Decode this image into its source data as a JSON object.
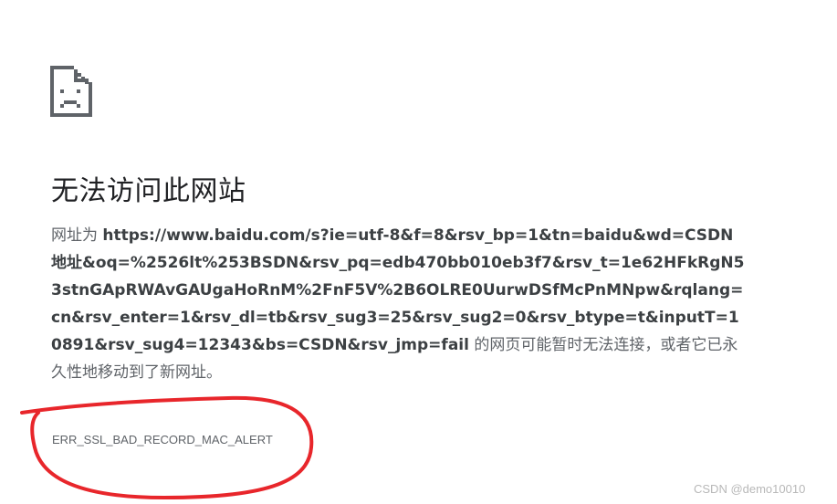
{
  "error_page": {
    "title": "无法访问此网站",
    "message_prefix": "网址为 ",
    "url": "https://www.baidu.com/s?ie=utf-8&f=8&rsv_bp=1&tn=baidu&wd=CSDN地址&oq=%2526lt%253BSDN&rsv_pq=edb470bb010eb3f7&rsv_t=1e62HFkRgN53stnGApRWAvGAUgaHoRnM%2FnF5V%2B6OLRE0UurwDSfMcPnMNpw&rqlang=cn&rsv_enter=1&rsv_dl=tb&rsv_sug3=25&rsv_sug2=0&rsv_btype=t&inputT=10891&rsv_sug4=12343&bs=CSDN&rsv_jmp=fail",
    "message_suffix": " 的网页可能暂时无法连接，或者它已永久性地移动到了新网址。",
    "error_code": "ERR_SSL_BAD_RECORD_MAC_ALERT",
    "icon": "broken-page-icon"
  },
  "annotation": {
    "color": "#e8262b"
  },
  "watermark": {
    "text": "CSDN @demo10010"
  }
}
